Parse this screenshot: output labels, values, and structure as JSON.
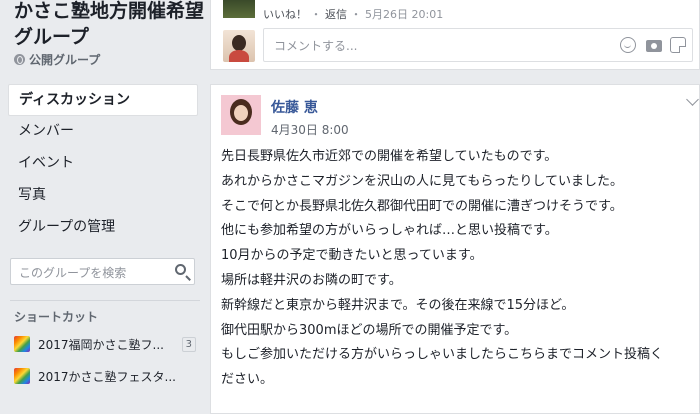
{
  "group": {
    "title": "かさこ塾地方開催希望グループ",
    "type_label": "公開グループ"
  },
  "nav": {
    "items": [
      {
        "label": "ディスカッション",
        "active": true
      },
      {
        "label": "メンバー"
      },
      {
        "label": "イベント"
      },
      {
        "label": "写真"
      },
      {
        "label": "グループの管理"
      }
    ]
  },
  "search": {
    "placeholder": "このグループを検索"
  },
  "shortcuts": {
    "heading": "ショートカット",
    "items": [
      {
        "label": "2017福岡かさこ塾フ...",
        "count": "3",
        "icon": "rainbow-icon"
      },
      {
        "label": "2017かさこ塾フェスタ...",
        "icon": "rainbow-icon"
      }
    ]
  },
  "previous_comment": {
    "like_label": "いいね！",
    "separator": "・",
    "reply_label": "返信",
    "timestamp": "5月26日 20:01"
  },
  "comment_box": {
    "placeholder": "コメントする..."
  },
  "post": {
    "author": "佐藤 恵",
    "timestamp": "4月30日 8:00",
    "lines": [
      "先日長野県佐久市近郊での開催を希望していたものです。",
      "あれからかさこマガジンを沢山の人に見てもらったりしていました。",
      "そこで何とか長野県北佐久郡御代田町での開催に漕ぎつけそうです。",
      "他にも参加希望の方がいらっしゃれば…と思い投稿です。",
      "10月からの予定で動きたいと思っています。",
      "場所は軽井沢のお隣の町です。",
      "新幹線だと東京から軽井沢まで。その後在来線で15分ほど。",
      "御代田駅から300mほどの場所での開催予定です。",
      "もしご参加いただける方がいらっしゃいましたらこちらまでコメント投稿く",
      "ださい。"
    ]
  },
  "colors": {
    "background": "#e9ebee",
    "link": "#385898",
    "muted": "#90949c"
  }
}
